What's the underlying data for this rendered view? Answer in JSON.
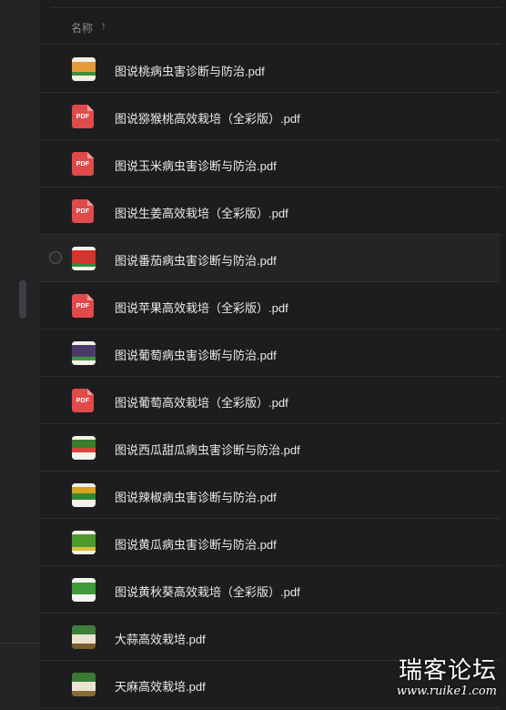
{
  "header": {
    "name_label": "名称",
    "sort_icon": "↑"
  },
  "files": [
    {
      "name": "图说桃病虫害诊断与防治.pdf",
      "icon": "book-cover-peach"
    },
    {
      "name": "图说猕猴桃高效栽培（全彩版）.pdf",
      "icon": "pdf",
      "icon_text": "PDF"
    },
    {
      "name": "图说玉米病虫害诊断与防治.pdf",
      "icon": "pdf",
      "icon_text": "PDF"
    },
    {
      "name": "图说生姜高效栽培（全彩版）.pdf",
      "icon": "pdf",
      "icon_text": "PDF"
    },
    {
      "name": "图说番茄病虫害诊断与防治.pdf",
      "icon": "book-cover-tomato"
    },
    {
      "name": "图说苹果高效栽培（全彩版）.pdf",
      "icon": "pdf",
      "icon_text": "PDF"
    },
    {
      "name": "图说葡萄病虫害诊断与防治.pdf",
      "icon": "book-cover-grape"
    },
    {
      "name": "图说葡萄高效栽培（全彩版）.pdf",
      "icon": "pdf",
      "icon_text": "PDF"
    },
    {
      "name": "图说西瓜甜瓜病虫害诊断与防治.pdf",
      "icon": "book-cover-melon"
    },
    {
      "name": "图说辣椒病虫害诊断与防治.pdf",
      "icon": "book-cover-pepper"
    },
    {
      "name": "图说黄瓜病虫害诊断与防治.pdf",
      "icon": "book-cover-cucumber"
    },
    {
      "name": "图说黄秋葵高效栽培（全彩版）.pdf",
      "icon": "book-cover-okra"
    },
    {
      "name": "大蒜高效栽培.pdf",
      "icon": "book-cover-garlic"
    },
    {
      "name": "天麻高效栽培.pdf",
      "icon": "book-cover-gastrodia"
    }
  ],
  "hover_row_index": 4,
  "colors": {
    "pdf_red": "#e04a4a",
    "background": "#1d1d1f",
    "divider": "#2f2f31"
  },
  "watermark": {
    "title": "瑞客论坛",
    "url": "www.ruike1.com"
  }
}
